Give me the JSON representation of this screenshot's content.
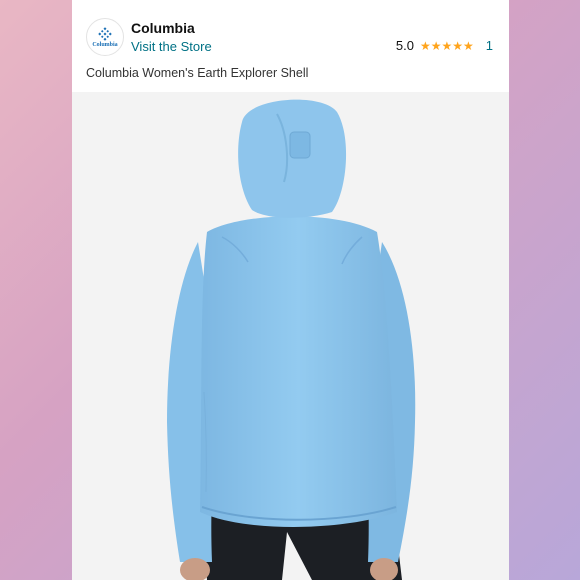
{
  "store": {
    "name": "Columbia",
    "link_label": "Visit the Store",
    "logo_text": "Columbia"
  },
  "rating": {
    "value": "5.0",
    "stars": 5,
    "count": "1"
  },
  "product": {
    "title": "Columbia Women's Earth Explorer Shell"
  },
  "colors": {
    "jacket": "#8ec5ec",
    "link": "#007185",
    "star": "#ffa41c"
  },
  "image": {
    "description_icon": "product-photo-jacket-back-view"
  }
}
